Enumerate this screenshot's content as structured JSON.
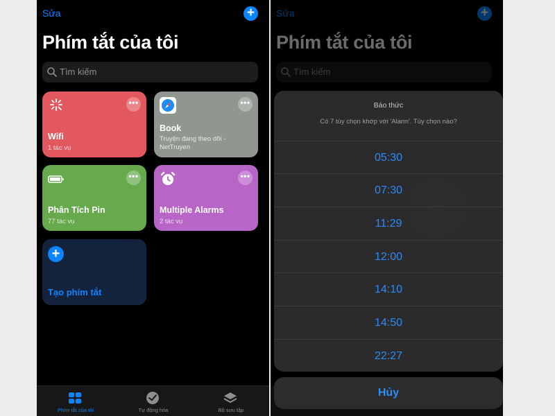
{
  "left_screen": {
    "nav": {
      "edit_label": "Sửa",
      "add_label": "+"
    },
    "title": "Phím tắt của tôi",
    "search": {
      "placeholder": "Tìm kiếm"
    },
    "cards": [
      {
        "name": "Wifi",
        "subtitle": "1 tác vụ",
        "color": "#e3585e",
        "icon": "sparkle-icon"
      },
      {
        "name": "Book",
        "subtitle": "Truyện đang theo dõi - NetTruyen",
        "color": "#8f9790",
        "icon": "safari-compass-icon"
      },
      {
        "name": "Phân Tích Pin",
        "subtitle": "77 tác vụ",
        "color": "#67a94d",
        "icon": "battery-icon"
      },
      {
        "name": "Multiple Alarms",
        "subtitle": "2 tác vụ",
        "color": "#b865c8",
        "icon": "alarm-clock-icon"
      }
    ],
    "more_label": "•••",
    "create": {
      "plus": "+",
      "label": "Tạo phím tắt"
    },
    "tabs": [
      {
        "label": "Phím tắt của tôi",
        "icon": "grid-icon",
        "active": true
      },
      {
        "label": "Tự động hóa",
        "icon": "clock-check-icon",
        "active": false
      },
      {
        "label": "Bộ sưu tập",
        "icon": "layers-icon",
        "active": false
      }
    ]
  },
  "right_screen": {
    "nav": {
      "edit_label": "Sửa",
      "add_label": "+"
    },
    "title": "Phím tắt của tôi",
    "search": {
      "placeholder": "Tìm kiếm"
    },
    "alert": {
      "title": "Báo thức",
      "message": "Có 7 tùy chọn khớp với 'Alarm'. Tùy chọn nào?",
      "options": [
        "05:30",
        "07:30",
        "11:29",
        "12:00",
        "14:10",
        "14:50",
        "22:27"
      ],
      "cancel": "Hủy"
    }
  },
  "colors": {
    "accent": "#0a84ff",
    "background": "#000000"
  }
}
